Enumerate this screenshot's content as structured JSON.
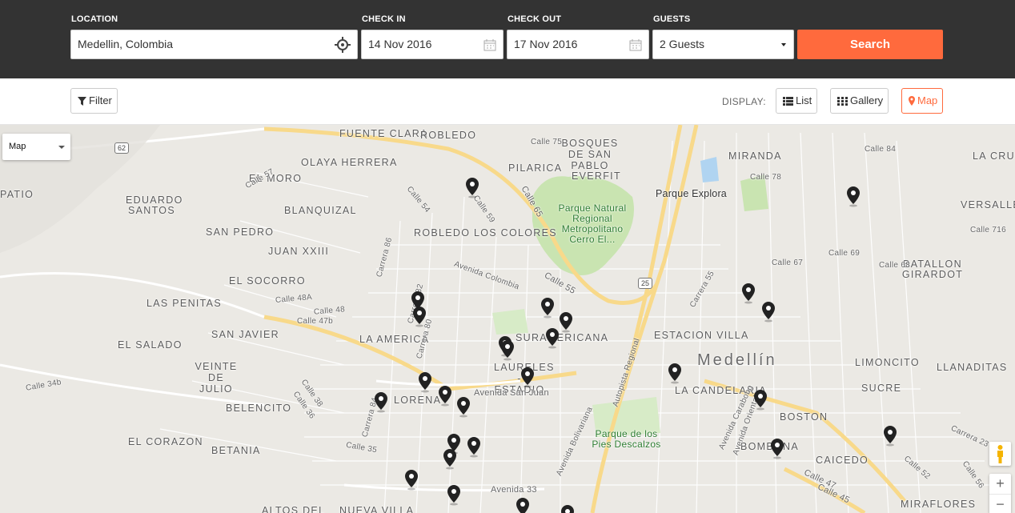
{
  "search": {
    "location_label": "LOCATION",
    "location_value": "Medellin, Colombia",
    "checkin_label": "CHECK IN",
    "checkin_value": "14 Nov 2016",
    "checkout_label": "CHECK OUT",
    "checkout_value": "17 Nov 2016",
    "guests_label": "GUESTS",
    "guests_value": "2 Guests",
    "search_button": "Search"
  },
  "toolbar": {
    "filter_label": "Filter",
    "display_label": "DISPLAY:",
    "list_label": "List",
    "gallery_label": "Gallery",
    "map_label": "Map"
  },
  "map": {
    "type_selected": "Map",
    "city_label": "Medellín",
    "neighborhoods": [
      "FUENTE CLARA",
      "ROBLEDO",
      "BOSQUES DE SAN PABLO",
      "MIRANDA",
      "OLAYA HERRERA",
      "PILARICA",
      "EVERFIT",
      "EL MORO",
      "EDUARDO SANTOS",
      "BLANQUIZAL",
      "SAN PEDRO",
      "JUAN XXIII",
      "ROBLEDO LOS COLORES",
      "EL SOCORRO",
      "LAS PENITAS",
      "SAN JAVIER",
      "EL SALADO",
      "LA AMERICA",
      "SURAMERICANA",
      "ESTACION VILLA",
      "VEINTE DE JULIO",
      "LAURELES - ESTADIO",
      "LORENA",
      "LA CANDELARIA",
      "BELENCITO",
      "BOSTON",
      "EL CORAZON",
      "BETANIA",
      "BOMBONA",
      "CAICEDO",
      "SUCRE",
      "LIMONCITO",
      "LLANADITAS",
      "BATALLON GIRARDOT",
      "VERSALLES",
      "LA CRUZ",
      "ALTOS DEL",
      "NUEVA VILLA",
      "MIRAFLORES",
      "PATIO"
    ],
    "places": [
      "Parque Explora",
      "Parque Natural Regional Metropolitano Cerro El...",
      "Parque de los Pies Descalzos"
    ],
    "streets": [
      "Calle 57",
      "Calle 75",
      "Calle 78",
      "Calle 84",
      "Calle 65",
      "Calle 59",
      "Calle 54",
      "Avenida Colombia",
      "Calle 55",
      "Calle 48A",
      "Calle 48",
      "Calle 47b",
      "Avenida San Juan",
      "Autopista Regional",
      "Carrera 86",
      "Carrera 82",
      "Carrera 80",
      "Carrera 84",
      "Calle 38",
      "Calle 36",
      "Calle 34b",
      "Calle 35",
      "Avenida 33",
      "Avenida Bolivariana",
      "Calle 67",
      "Calle 69",
      "Calle 68",
      "Calle 716",
      "Carrera 55",
      "Avenida Carabobo",
      "Avenida Oriental",
      "Calle 47",
      "Calle 45",
      "Calle 52",
      "Carrera 23",
      "Calle 56"
    ],
    "badges": [
      "62",
      "25"
    ]
  },
  "colors": {
    "header_bg": "#333333",
    "accent": "#ff6a3d",
    "map_bg": "#ebe9e4",
    "park": "#c9e4b1",
    "road": "#ffffff",
    "highway": "#f8d98a"
  }
}
